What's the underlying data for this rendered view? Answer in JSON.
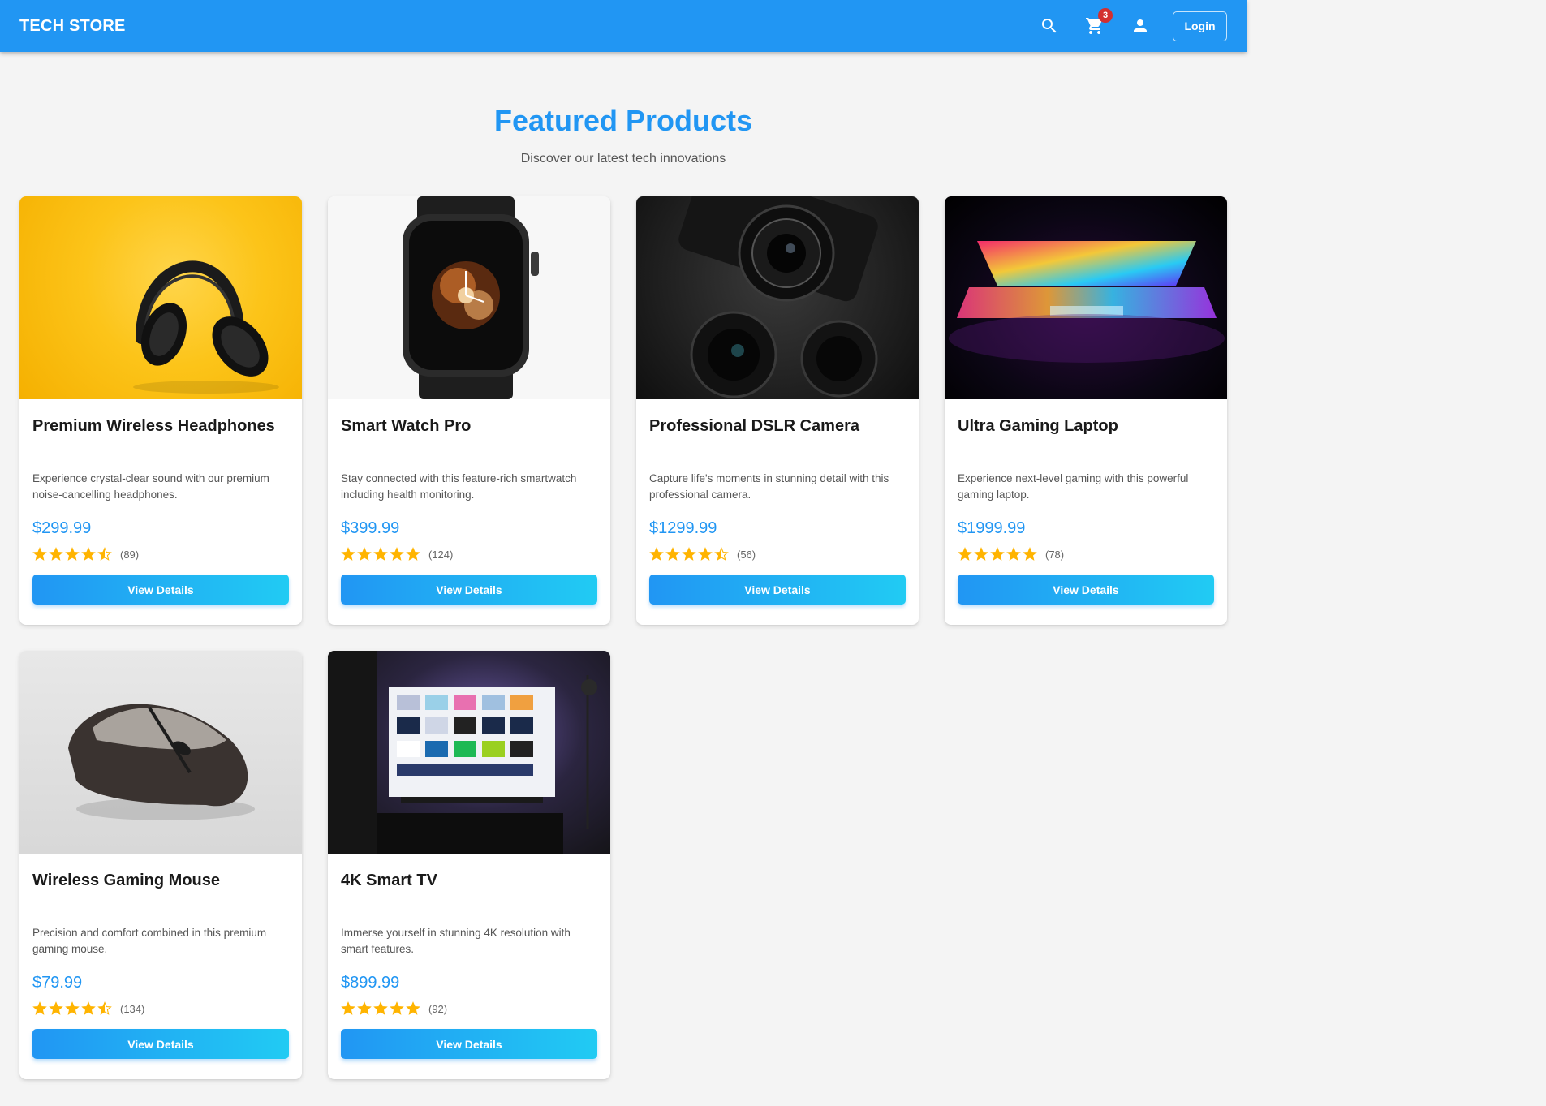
{
  "header": {
    "brand": "TECH STORE",
    "search_icon": "search-icon",
    "cart_icon": "cart-icon",
    "cart_count": "3",
    "account_icon": "account-icon",
    "login_label": "Login"
  },
  "hero": {
    "title": "Featured Products",
    "subtitle": "Discover our latest tech innovations"
  },
  "colors": {
    "primary": "#2196f3",
    "accent": "#21cbf3",
    "star": "#ffb400",
    "badge": "#d32f2f"
  },
  "products": [
    {
      "name": "Premium Wireless Headphones",
      "description": "Experience crystal-clear sound with our premium noise-cancelling headphones.",
      "price": "$299.99",
      "rating": 4.5,
      "reviews": "(89)",
      "button": "View Details"
    },
    {
      "name": "Smart Watch Pro",
      "description": "Stay connected with this feature-rich smartwatch including health monitoring.",
      "price": "$399.99",
      "rating": 5,
      "reviews": "(124)",
      "button": "View Details"
    },
    {
      "name": "Professional DSLR Camera",
      "description": "Capture life's moments in stunning detail with this professional camera.",
      "price": "$1299.99",
      "rating": 4.5,
      "reviews": "(56)",
      "button": "View Details"
    },
    {
      "name": "Ultra Gaming Laptop",
      "description": "Experience next-level gaming with this powerful gaming laptop.",
      "price": "$1999.99",
      "rating": 5,
      "reviews": "(78)",
      "button": "View Details"
    },
    {
      "name": "Wireless Gaming Mouse",
      "description": "Precision and comfort combined in this premium gaming mouse.",
      "price": "$79.99",
      "rating": 4.5,
      "reviews": "(134)",
      "button": "View Details"
    },
    {
      "name": "4K Smart TV",
      "description": "Immerse yourself in stunning 4K resolution with smart features.",
      "price": "$899.99",
      "rating": 5,
      "reviews": "(92)",
      "button": "View Details"
    }
  ]
}
